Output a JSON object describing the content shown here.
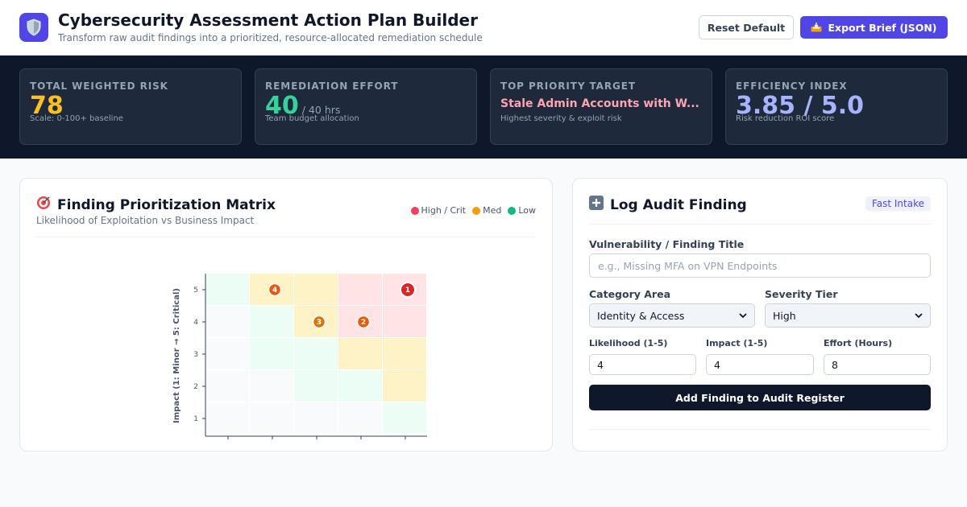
{
  "header": {
    "title": "Cybersecurity Assessment Action Plan Builder",
    "subtitle": "Transform raw audit findings into a prioritized, resource-allocated remediation schedule",
    "reset_label": "Reset Default",
    "export_label": "Export Brief (JSON)",
    "logo_icon": "shield-icon",
    "export_icon": "inbox-tray-icon"
  },
  "kpis": {
    "risk": {
      "label": "TOTAL WEIGHTED RISK",
      "value": "78",
      "note": "Scale: 0-100+ baseline",
      "color": "#fbbf24"
    },
    "effort": {
      "label": "REMEDIATION EFFORT",
      "value": "40",
      "unit": "/ 40 hrs",
      "note": "Team budget allocation",
      "color": "#34d399"
    },
    "target": {
      "label": "TOP PRIORITY TARGET",
      "value": "Stale Admin Accounts with W...",
      "note": "Highest severity & exploit risk",
      "color": "#fda4af"
    },
    "efficiency": {
      "label": "EFFICIENCY INDEX",
      "value": "3.85 / 5.0",
      "note": "Risk reduction ROI score",
      "color": "#a5b4fc"
    }
  },
  "matrix": {
    "title": "Finding Prioritization Matrix",
    "subtitle": "Likelihood of Exploitation vs Business Impact",
    "title_icon": "target-icon",
    "legend": [
      {
        "label": "High / Crit",
        "color": "#f43f5e"
      },
      {
        "label": "Med",
        "color": "#f59e0b"
      },
      {
        "label": "Low",
        "color": "#10b981"
      }
    ]
  },
  "chart_data": {
    "type": "scatter",
    "ylabel": "Impact (1: Minor → 5: Critical)",
    "xlabel": "",
    "xlim": [
      1,
      5
    ],
    "ylim": [
      1,
      5
    ],
    "yticks": [
      "1",
      "2",
      "3",
      "4",
      "5"
    ],
    "cell_colors": [
      [
        "#f8fafc",
        "#f8fafc",
        "#f8fafc",
        "#f8fafc",
        "#ecfdf5"
      ],
      [
        "#f8fafc",
        "#f8fafc",
        "#ecfdf5",
        "#ecfdf5",
        "#fef3c7"
      ],
      [
        "#f8fafc",
        "#ecfdf5",
        "#ecfdf5",
        "#fef3c7",
        "#fef3c7"
      ],
      [
        "#f8fafc",
        "#ecfdf5",
        "#fef3c7",
        "#ffe4e6",
        "#ffe4e6"
      ],
      [
        "#ecfdf5",
        "#fef3c7",
        "#fef3c7",
        "#ffe4e6",
        "#ffe4e6"
      ]
    ],
    "points": [
      {
        "label": "1",
        "likelihood": 5,
        "impact": 5,
        "color": "#dc2626"
      },
      {
        "label": "2",
        "likelihood": 4,
        "impact": 4,
        "color": "#ea580c"
      },
      {
        "label": "3",
        "likelihood": 3,
        "impact": 4,
        "color": "#d97706"
      },
      {
        "label": "4",
        "likelihood": 2,
        "impact": 5,
        "color": "#ea580c"
      }
    ]
  },
  "form": {
    "title": "Log Audit Finding",
    "title_icon": "plus-icon",
    "badge": "Fast Intake",
    "title_label": "Vulnerability / Finding Title",
    "title_placeholder": "e.g., Missing MFA on VPN Endpoints",
    "category_label": "Category Area",
    "category_value": "Identity & Access",
    "severity_label": "Severity Tier",
    "severity_value": "High",
    "likelihood_label": "Likelihood (1-5)",
    "likelihood_value": "4",
    "impact_label": "Impact (1-5)",
    "impact_value": "4",
    "effort_label": "Effort (Hours)",
    "effort_value": "8",
    "submit_label": "Add Finding to Audit Register"
  }
}
